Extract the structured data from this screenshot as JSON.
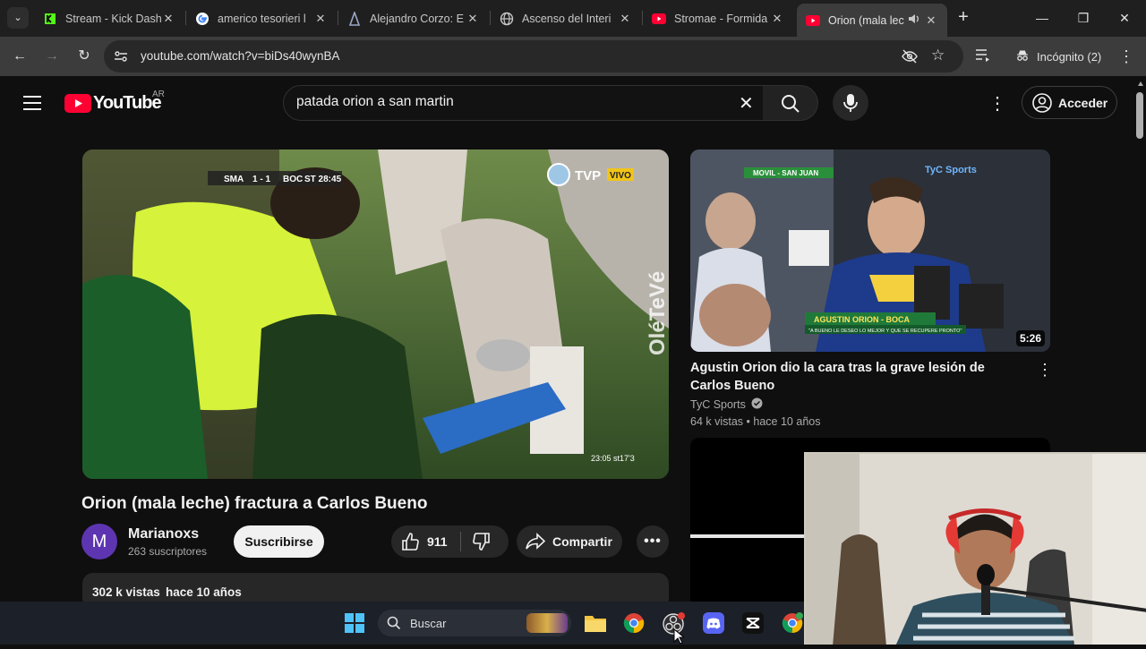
{
  "browser": {
    "tabs": [
      {
        "title": "Stream - Kick Dash",
        "favicon": "kick-icon",
        "active": false
      },
      {
        "title": "americo tesorieri l",
        "favicon": "google-icon",
        "active": false
      },
      {
        "title": "Alejandro Corzo: E",
        "favicon": "site-icon",
        "active": false
      },
      {
        "title": "Ascenso del Interi",
        "favicon": "globe-icon",
        "active": false
      },
      {
        "title": "Stromae - Formida",
        "favicon": "youtube-icon",
        "active": false
      },
      {
        "title": "Orion (mala lec",
        "favicon": "youtube-icon",
        "active": true
      }
    ],
    "url": "youtube.com/watch?v=biDs40wynBA",
    "incognito_label": "Incógnito (2)",
    "accent": "#ff0033"
  },
  "youtube": {
    "logo_text": "YouTube",
    "country": "AR",
    "search_value": "patada orion a san martin",
    "signin_label": "Acceder",
    "video": {
      "title": "Orion (mala leche) fractura a Carlos Bueno",
      "channel": "Marianoxs",
      "channel_initial": "M",
      "subscribers": "263 suscriptores",
      "subscribe_label": "Suscribirse",
      "likes": "911",
      "share_label": "Compartir",
      "views": "302 k vistas",
      "age": "hace 10 años",
      "overlay": {
        "score_home": "SMA",
        "score": "1 - 1",
        "score_away": "BOC",
        "time": "ST 28:45",
        "network": "TVP",
        "live": "VIVO",
        "watermark": "OléTeVé",
        "clock": "23:05 st17'3"
      }
    },
    "related": [
      {
        "title": "Agustin Orion dio la cara tras la grave lesión de Carlos Bueno",
        "channel": "TyC Sports",
        "verified": true,
        "views": "64 k vistas",
        "age": "hace 10 años",
        "duration": "5:26",
        "thumb_caption": "AGUSTIN ORION - BOCA",
        "thumb_sub": "\"A BUENO LE DESEO LO MEJOR Y QUE SE RECUPERE PRONTO\"",
        "thumb_top": "MOVIL - SAN JUAN",
        "thumb_logo": "TyC Sports"
      }
    ]
  },
  "taskbar": {
    "search_placeholder": "Buscar"
  }
}
